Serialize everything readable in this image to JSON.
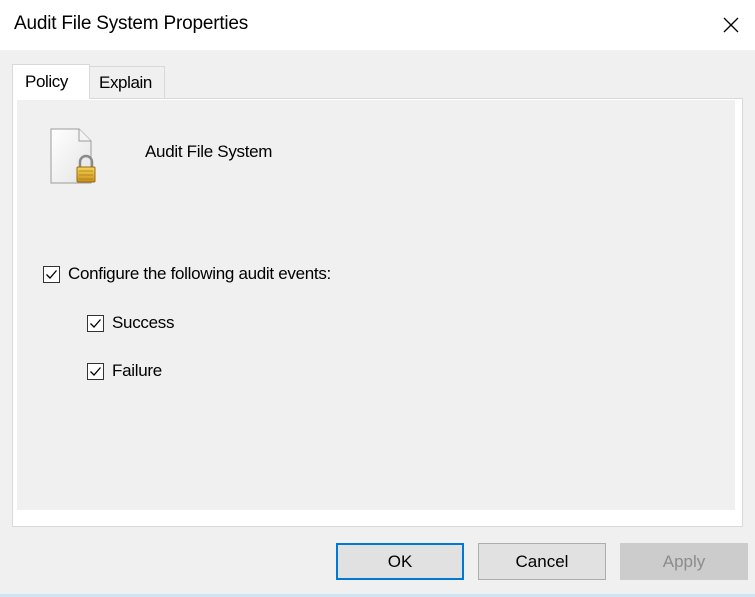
{
  "window": {
    "title": "Audit File System Properties"
  },
  "tabs": [
    {
      "label": "Policy",
      "selected": true
    },
    {
      "label": "Explain",
      "selected": false
    }
  ],
  "policy": {
    "name": "Audit File System",
    "icon": "document-lock-icon"
  },
  "options": {
    "configure": {
      "label": "Configure the following audit events:",
      "checked": true
    },
    "success": {
      "label": "Success",
      "checked": true
    },
    "failure": {
      "label": "Failure",
      "checked": true
    }
  },
  "buttons": {
    "ok": "OK",
    "cancel": "Cancel",
    "apply": "Apply"
  },
  "colors": {
    "accent": "#0078d7",
    "window_bg": "#f0f0f0",
    "lock": "#e8b820"
  }
}
